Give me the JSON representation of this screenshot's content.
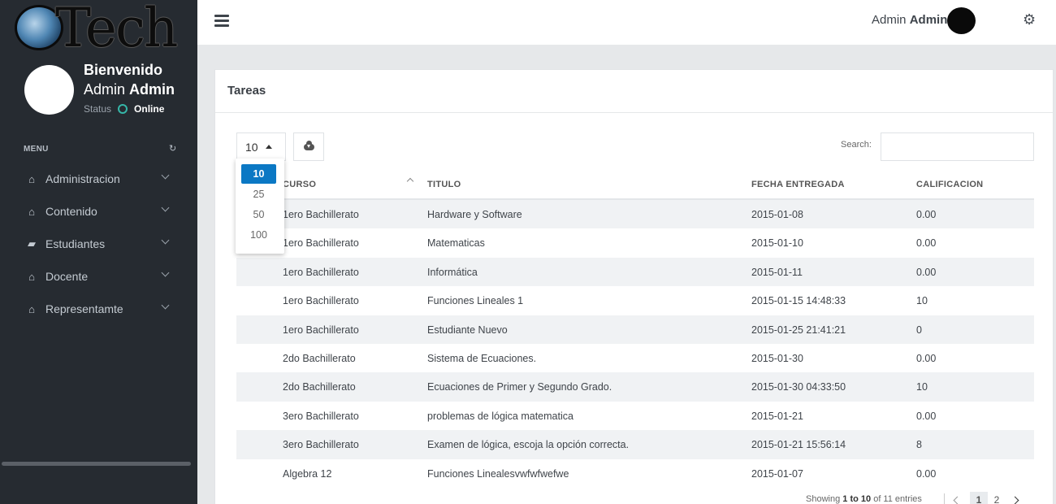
{
  "logo": {
    "text": "Tech",
    "icon": "globe-logo"
  },
  "sidebar": {
    "welcome": "Bienvenido",
    "user_first": "Admin",
    "user_last": "Admin",
    "status_label": "Status",
    "status_value": "Online",
    "menu_label": "MENU",
    "items": [
      {
        "label": "Administracion",
        "icon": "home-icon"
      },
      {
        "label": "Contenido",
        "icon": "home-icon"
      },
      {
        "label": "Estudiantes",
        "icon": "book-icon"
      },
      {
        "label": "Docente",
        "icon": "home-icon"
      },
      {
        "label": "Representamte",
        "icon": "home-icon"
      }
    ]
  },
  "header": {
    "user_first": "Admin",
    "user_last": "Admin"
  },
  "panel": {
    "title": "Tareas",
    "page_length": "10",
    "page_length_options": [
      "10",
      "25",
      "50",
      "100"
    ],
    "search_label": "Search:",
    "search_value": "",
    "columns": [
      "CURSO",
      "TITULO",
      "FECHA ENTREGADA",
      "CALIFICACION"
    ],
    "rows": [
      [
        "1ero Bachillerato",
        "Hardware y Software",
        "2015-01-08",
        "0.00"
      ],
      [
        "1ero Bachillerato",
        "Matematicas",
        "2015-01-10",
        "0.00"
      ],
      [
        "1ero Bachillerato",
        "Informática",
        "2015-01-11",
        "0.00"
      ],
      [
        "1ero Bachillerato",
        "Funciones Lineales 1",
        "2015-01-15 14:48:33",
        "10"
      ],
      [
        "1ero Bachillerato",
        "Estudiante Nuevo",
        "2015-01-25 21:41:21",
        "0"
      ],
      [
        "2do Bachillerato",
        "Sistema de Ecuaciones.",
        "2015-01-30",
        "0.00"
      ],
      [
        "2do Bachillerato",
        "Ecuaciones de Primer y Segundo Grado.",
        "2015-01-30 04:33:50",
        "10"
      ],
      [
        "3ero Bachillerato",
        "problemas de lógica matematica",
        "2015-01-21",
        "0.00"
      ],
      [
        "3ero Bachillerato",
        "Examen de lógica, escoja la opción correcta.",
        "2015-01-21 15:56:14",
        "8"
      ],
      [
        "Algebra 12",
        "Funciones Linealesvwfwfwefwe",
        "2015-01-07",
        "0.00"
      ]
    ],
    "info_prefix": "Showing ",
    "info_from": "1",
    "info_to": "to 10",
    "info_suffix": " of 11 entries",
    "pages": [
      "1",
      "2"
    ],
    "current_page": "1"
  }
}
